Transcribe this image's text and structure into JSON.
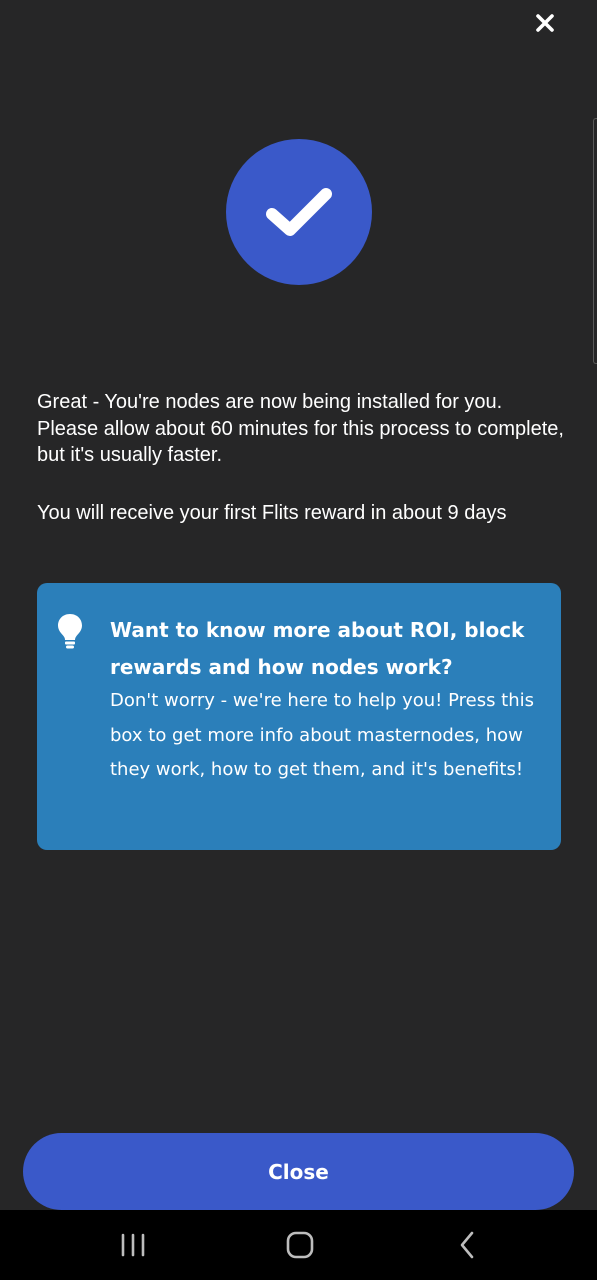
{
  "dialog": {
    "close_icon": "close-icon",
    "success_icon": "checkmark-icon",
    "accent_color": "#3a59c9",
    "message_line1": "Great - You're nodes are now being installed for you. Please allow about 60 minutes for this process to complete, but it's usually faster.",
    "message_line2": "You will receive your first Flits reward in about 9 days"
  },
  "info_box": {
    "icon": "lightbulb-icon",
    "background_color": "#2b7fba",
    "title": "Want to know more about ROI, block rewards and how nodes work?",
    "body": "Don't worry - we're here to help you! Press this box to get more info about masternodes, how they work, how to get them, and it's benefits!"
  },
  "footer": {
    "close_label": "Close"
  },
  "system_nav": {
    "recents_icon": "recent-apps-icon",
    "home_icon": "home-icon",
    "back_icon": "back-icon"
  }
}
